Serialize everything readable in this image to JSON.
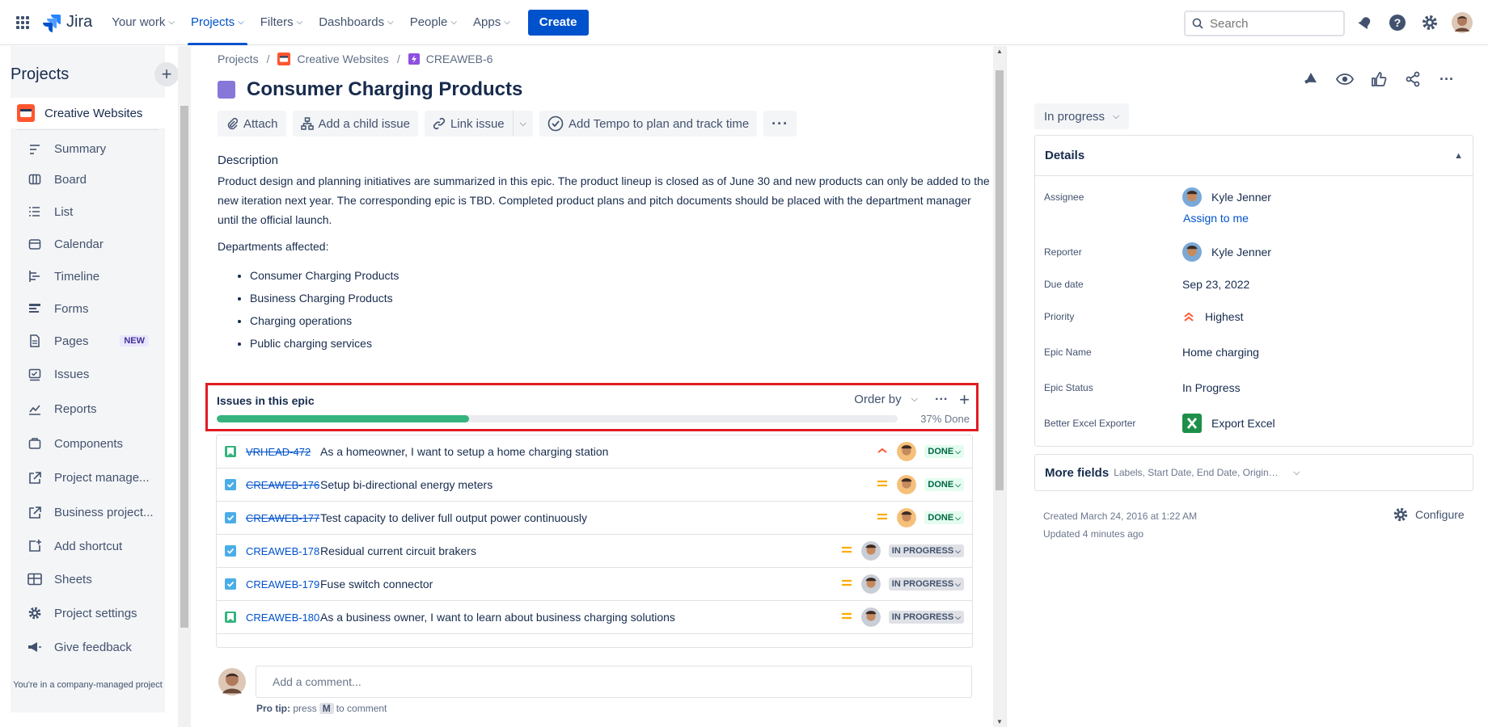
{
  "nav": {
    "logo": "Jira",
    "items": [
      {
        "label": "Your work"
      },
      {
        "label": "Projects"
      },
      {
        "label": "Filters"
      },
      {
        "label": "Dashboards"
      },
      {
        "label": "People"
      },
      {
        "label": "Apps"
      }
    ],
    "create_label": "Create",
    "search_placeholder": "Search"
  },
  "sidebar": {
    "title": "Projects",
    "project_name": "Creative Websites",
    "items": [
      {
        "label": "Summary",
        "icon": "summary-icon"
      },
      {
        "label": "Board",
        "icon": "board-icon"
      },
      {
        "label": "List",
        "icon": "list-icon"
      },
      {
        "label": "Calendar",
        "icon": "calendar-icon"
      },
      {
        "label": "Timeline",
        "icon": "timeline-icon"
      },
      {
        "label": "Forms",
        "icon": "forms-icon"
      },
      {
        "label": "Pages",
        "icon": "pages-icon",
        "badge": "NEW"
      },
      {
        "label": "Issues",
        "icon": "issues-icon"
      },
      {
        "label": "Reports",
        "icon": "reports-icon"
      },
      {
        "label": "Components",
        "icon": "components-icon"
      },
      {
        "label": "Project manage...",
        "icon": "external-link-icon"
      },
      {
        "label": "Business project...",
        "icon": "external-link-icon"
      },
      {
        "label": "Add shortcut",
        "icon": "add-shortcut-icon"
      },
      {
        "label": "Sheets",
        "icon": "sheets-icon"
      },
      {
        "label": "Project settings",
        "icon": "gear-icon"
      },
      {
        "label": "Give feedback",
        "icon": "megaphone-icon"
      }
    ],
    "footer": "You're in a company-managed project"
  },
  "main": {
    "breadcrumb": [
      "Projects",
      "Creative Websites",
      "CREAWEB-6"
    ],
    "title": "Consumer Charging Products",
    "actions": {
      "attach": "Attach",
      "child": "Add a child issue",
      "link": "Link issue",
      "tempo": "Add Tempo to plan and track time"
    },
    "description_label": "Description",
    "description": "Product design and planning initiatives are summarized in this epic. The product lineup is closed as of June 30 and new products can only be added to the new iteration next year. The corresponding epic is TBD. Completed product plans and pitch documents should be placed with the department manager until the official launch.",
    "departments_label": "Departments affected:",
    "departments": [
      "Consumer Charging Products",
      "Business Charging Products",
      "Charging operations",
      "Public charging services"
    ],
    "epic": {
      "title": "Issues in this epic",
      "order_by": "Order by",
      "progress_label": "37% Done",
      "progress": 0.37
    },
    "children": [
      {
        "key": "VRHEAD-472",
        "summary": "As a homeowner, I want to setup a home charging station",
        "status": "DONE",
        "done": true,
        "type": "story",
        "priority": "high"
      },
      {
        "key": "CREAWEB-176",
        "summary": "Setup bi-directional energy meters",
        "status": "DONE",
        "done": true,
        "type": "task",
        "priority": "medium"
      },
      {
        "key": "CREAWEB-177",
        "summary": "Test capacity to deliver full output power continuously",
        "status": "DONE",
        "done": true,
        "type": "task",
        "priority": "medium"
      },
      {
        "key": "CREAWEB-178",
        "summary": "Residual current circuit brakers",
        "status": "IN PROGRESS",
        "done": false,
        "type": "task",
        "priority": "medium"
      },
      {
        "key": "CREAWEB-179",
        "summary": "Fuse switch connector",
        "status": "IN PROGRESS",
        "done": false,
        "type": "task",
        "priority": "medium"
      },
      {
        "key": "CREAWEB-180",
        "summary": "As a business owner, I want to learn about business charging solutions",
        "status": "IN PROGRESS",
        "done": false,
        "type": "story",
        "priority": "medium"
      }
    ],
    "comment_placeholder": "Add a comment...",
    "protip_prefix": "Pro tip:",
    "protip_press": "press",
    "protip_key": "M",
    "protip_suffix": "to comment"
  },
  "right": {
    "status": "In progress",
    "details_title": "Details",
    "fields": {
      "assignee_label": "Assignee",
      "assignee": "Kyle Jenner",
      "assign_me": "Assign to me",
      "reporter_label": "Reporter",
      "reporter": "Kyle Jenner",
      "due_label": "Due date",
      "due": "Sep 23, 2022",
      "priority_label": "Priority",
      "priority": "Highest",
      "epic_name_label": "Epic Name",
      "epic_name": "Home charging",
      "epic_status_label": "Epic Status",
      "epic_status": "In Progress",
      "excel_label": "Better Excel Exporter",
      "excel": "Export Excel"
    },
    "more_fields": "More fields",
    "more_fields_list": "Labels, Start Date, End Date, Original estimate, Time tracking, Components, ...",
    "created": "Created March 24, 2016 at 1:22 AM",
    "updated": "Updated 4 minutes ago",
    "configure": "Configure"
  },
  "colors": {
    "brand": "#0052cc",
    "done_green": "#36b37e",
    "highlight_red": "#e11c24",
    "epic_purple": "#8777d9",
    "priority_orange": "#ff8b00"
  }
}
